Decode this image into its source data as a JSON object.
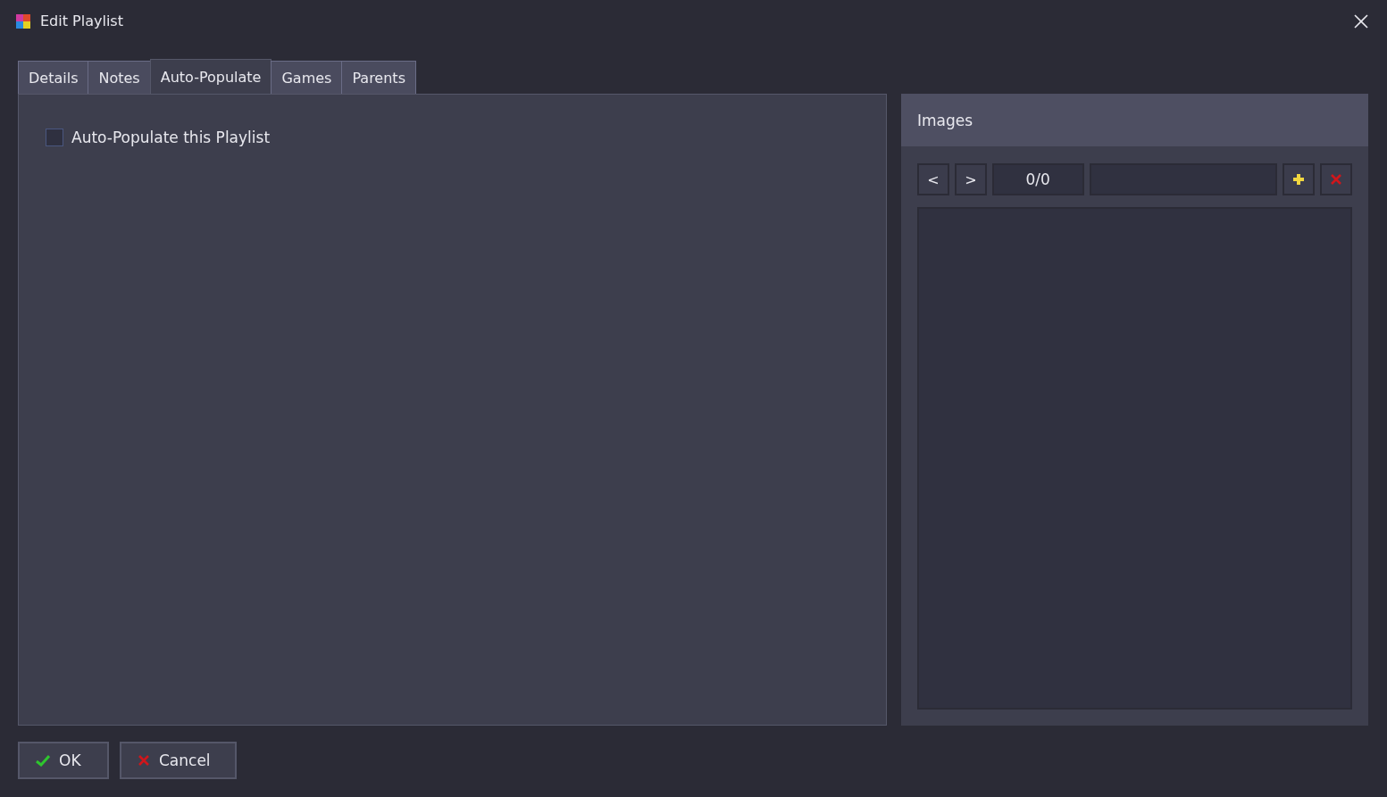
{
  "window": {
    "title": "Edit Playlist"
  },
  "tabs": [
    {
      "label": "Details",
      "selected": false
    },
    {
      "label": "Notes",
      "selected": false
    },
    {
      "label": "Auto-Populate",
      "selected": true
    },
    {
      "label": "Games",
      "selected": false
    },
    {
      "label": "Parents",
      "selected": false
    }
  ],
  "auto_populate": {
    "label": "Auto-Populate this Playlist",
    "checked": false
  },
  "images": {
    "title": "Images",
    "prev": "<",
    "next": ">",
    "counter": "0/0"
  },
  "buttons": [
    {
      "label": "OK",
      "kind": "ok"
    },
    {
      "label": "Cancel",
      "kind": "cancel"
    }
  ]
}
